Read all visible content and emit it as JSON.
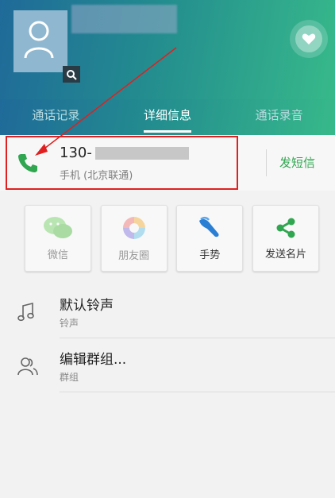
{
  "tabs": [
    {
      "label": "通话记录"
    },
    {
      "label": "详细信息"
    },
    {
      "label": "通话录音"
    }
  ],
  "phone": {
    "number_prefix": "130-",
    "type": "手机 (北京联通)",
    "sms_label": "发短信"
  },
  "actions": [
    {
      "label": "微信",
      "icon": "wechat-icon"
    },
    {
      "label": "朋友圈",
      "icon": "moments-icon"
    },
    {
      "label": "手势",
      "icon": "gesture-icon"
    },
    {
      "label": "发送名片",
      "icon": "share-icon"
    }
  ],
  "ringtone": {
    "title": "默认铃声",
    "subtitle": "铃声"
  },
  "group": {
    "title": "编辑群组...",
    "subtitle": "群组"
  },
  "colors": {
    "accent_green": "#2fa64f",
    "highlight_red": "#e02020"
  }
}
